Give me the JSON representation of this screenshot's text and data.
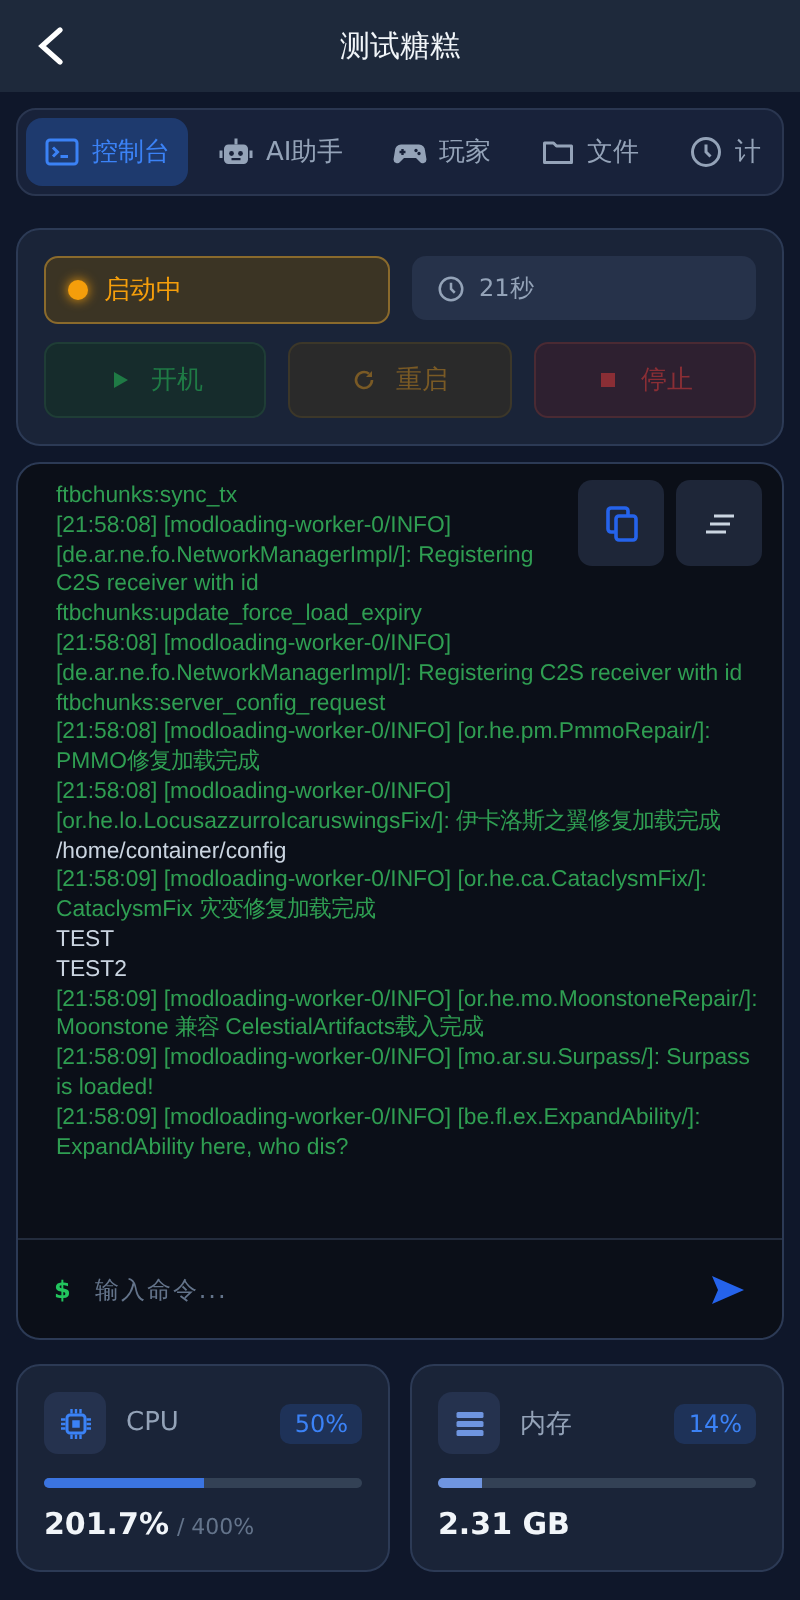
{
  "header": {
    "title": "测试糖糕"
  },
  "tabs": [
    {
      "label": "控制台",
      "kind": "console",
      "selected": true
    },
    {
      "label": "AI助手",
      "kind": "robot",
      "selected": false
    },
    {
      "label": "玩家",
      "kind": "gamepad",
      "selected": false
    },
    {
      "label": "文件",
      "kind": "folder",
      "selected": false
    },
    {
      "label": "计",
      "kind": "clock",
      "selected": false
    }
  ],
  "status": {
    "label": "启动中",
    "kind": "starting",
    "uptime": "21秒"
  },
  "actions": [
    {
      "label": "开机",
      "kind": "start",
      "disabled": true
    },
    {
      "label": "重启",
      "kind": "restart",
      "disabled": true
    },
    {
      "label": "停止",
      "kind": "stop",
      "disabled": true
    }
  ],
  "console": {
    "lines": [
      {
        "kind": "info",
        "text": "ftbchunks:sync_tx"
      },
      {
        "kind": "info",
        "text": "[21:58:08] [modloading-worker-0/INFO] [de.ar.ne.fo.NetworkManagerImpl/]: Registering C2S receiver with id ftbchunks:update_force_load_expiry"
      },
      {
        "kind": "info",
        "text": "[21:58:08] [modloading-worker-0/INFO] [de.ar.ne.fo.NetworkManagerImpl/]: Registering C2S receiver with id ftbchunks:server_config_request"
      },
      {
        "kind": "info",
        "text": "[21:58:08] [modloading-worker-0/INFO] [or.he.pm.PmmoRepair/]: PMMO修复加载完成"
      },
      {
        "kind": "info",
        "text": "[21:58:08] [modloading-worker-0/INFO] [or.he.lo.LocusazzurroIcaruswingsFix/]: 伊卡洛斯之翼修复加载完成"
      },
      {
        "kind": "plain",
        "text": "/home/container/config"
      },
      {
        "kind": "info",
        "text": "[21:58:09] [modloading-worker-0/INFO] [or.he.ca.CataclysmFix/]: CataclysmFix 灾变修复加载完成"
      },
      {
        "kind": "plain",
        "text": "TEST"
      },
      {
        "kind": "plain",
        "text": "TEST2"
      },
      {
        "kind": "info",
        "text": "[21:58:09] [modloading-worker-0/INFO] [or.he.mo.MoonstoneRepair/]: Moonstone 兼容 CelestialArtifacts载入完成"
      },
      {
        "kind": "info",
        "text": "[21:58:09] [modloading-worker-0/INFO] [mo.ar.su.Surpass/]: Surpass is loaded!"
      },
      {
        "kind": "info",
        "text": "[21:58:09] [modloading-worker-0/INFO] [be.fl.ex.ExpandAbility/]: ExpandAbility here, who dis?"
      }
    ],
    "prompt": "$",
    "placeholder": "输入命令..."
  },
  "stats": [
    {
      "kind": "cpu",
      "label": "CPU",
      "percent": "50%",
      "level": 0.5,
      "value": "201.7%",
      "limit": "/ 400%"
    },
    {
      "kind": "memory",
      "label": "内存",
      "percent": "14%",
      "level": 0.14,
      "value": "2.31 GB"
    }
  ]
}
